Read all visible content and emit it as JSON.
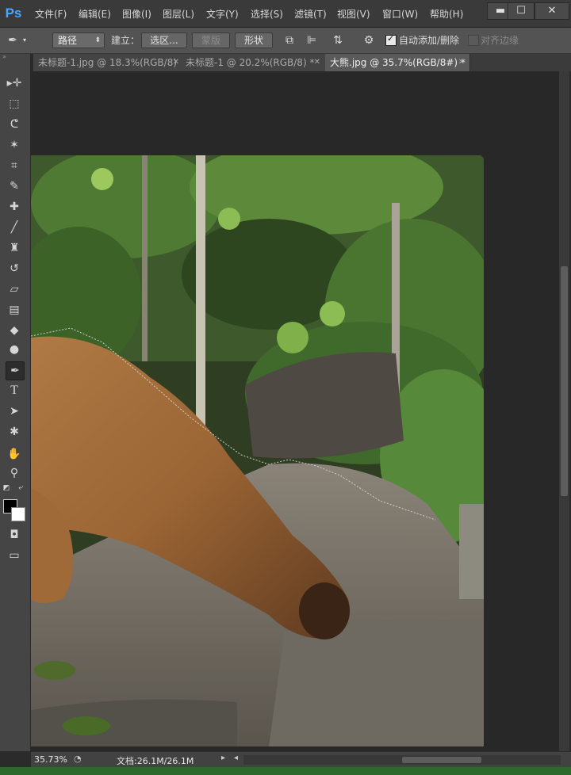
{
  "app": {
    "logo": "Ps",
    "menus": [
      "文件(F)",
      "编辑(E)",
      "图像(I)",
      "图层(L)",
      "文字(Y)",
      "选择(S)",
      "滤镜(T)",
      "视图(V)",
      "窗口(W)",
      "帮助(H)"
    ],
    "window_controls": {
      "minimize": "▬",
      "maximize": "☐",
      "close": "✕"
    }
  },
  "options": {
    "tool_mode": "路径",
    "make_label": "建立：",
    "selection_btn": "选区...",
    "mask_btn": "蒙版",
    "shape_btn": "形状",
    "auto_add_delete": {
      "label": "自动添加/删除",
      "checked": true
    },
    "align_edges": {
      "label": "对齐边缘",
      "checked": false
    }
  },
  "tabs": [
    {
      "title": "未标题-1.jpg @ 18.3%(RGB/8)",
      "active": false
    },
    {
      "title": "未标题-1 @ 20.2%(RGB/8) *",
      "active": false
    },
    {
      "title": "大熊.jpg @ 35.7%(RGB/8#) *",
      "active": true
    }
  ],
  "tools": [
    {
      "name": "move-tool",
      "icon": "▸✛"
    },
    {
      "name": "marquee-tool",
      "icon": "⬚"
    },
    {
      "name": "lasso-tool",
      "icon": "ᕦ"
    },
    {
      "name": "magic-wand-tool",
      "icon": "✶"
    },
    {
      "name": "crop-tool",
      "icon": "⌗"
    },
    {
      "name": "eyedropper-tool",
      "icon": "✎"
    },
    {
      "name": "healing-brush-tool",
      "icon": "✚"
    },
    {
      "name": "brush-tool",
      "icon": "╱"
    },
    {
      "name": "clone-stamp-tool",
      "icon": "♜"
    },
    {
      "name": "history-brush-tool",
      "icon": "↺"
    },
    {
      "name": "eraser-tool",
      "icon": "▱"
    },
    {
      "name": "gradient-tool",
      "icon": "▤"
    },
    {
      "name": "blur-tool",
      "icon": "◆"
    },
    {
      "name": "dodge-tool",
      "icon": "●"
    },
    {
      "name": "pen-tool",
      "icon": "✒"
    },
    {
      "name": "type-tool",
      "icon": "T"
    },
    {
      "name": "path-selection-tool",
      "icon": "➤"
    },
    {
      "name": "custom-shape-tool",
      "icon": "✱"
    },
    {
      "name": "hand-tool",
      "icon": "✋"
    },
    {
      "name": "zoom-tool",
      "icon": "⚲"
    }
  ],
  "status": {
    "zoom": "35.73%",
    "doc_info": "文档:26.1M/26.1M"
  },
  "colors": {
    "menubar": "#3a3a3a",
    "optionsbar": "#535353",
    "toolbar": "#454545",
    "workspace": "#282828",
    "ps_logo": "#48a6ff"
  }
}
